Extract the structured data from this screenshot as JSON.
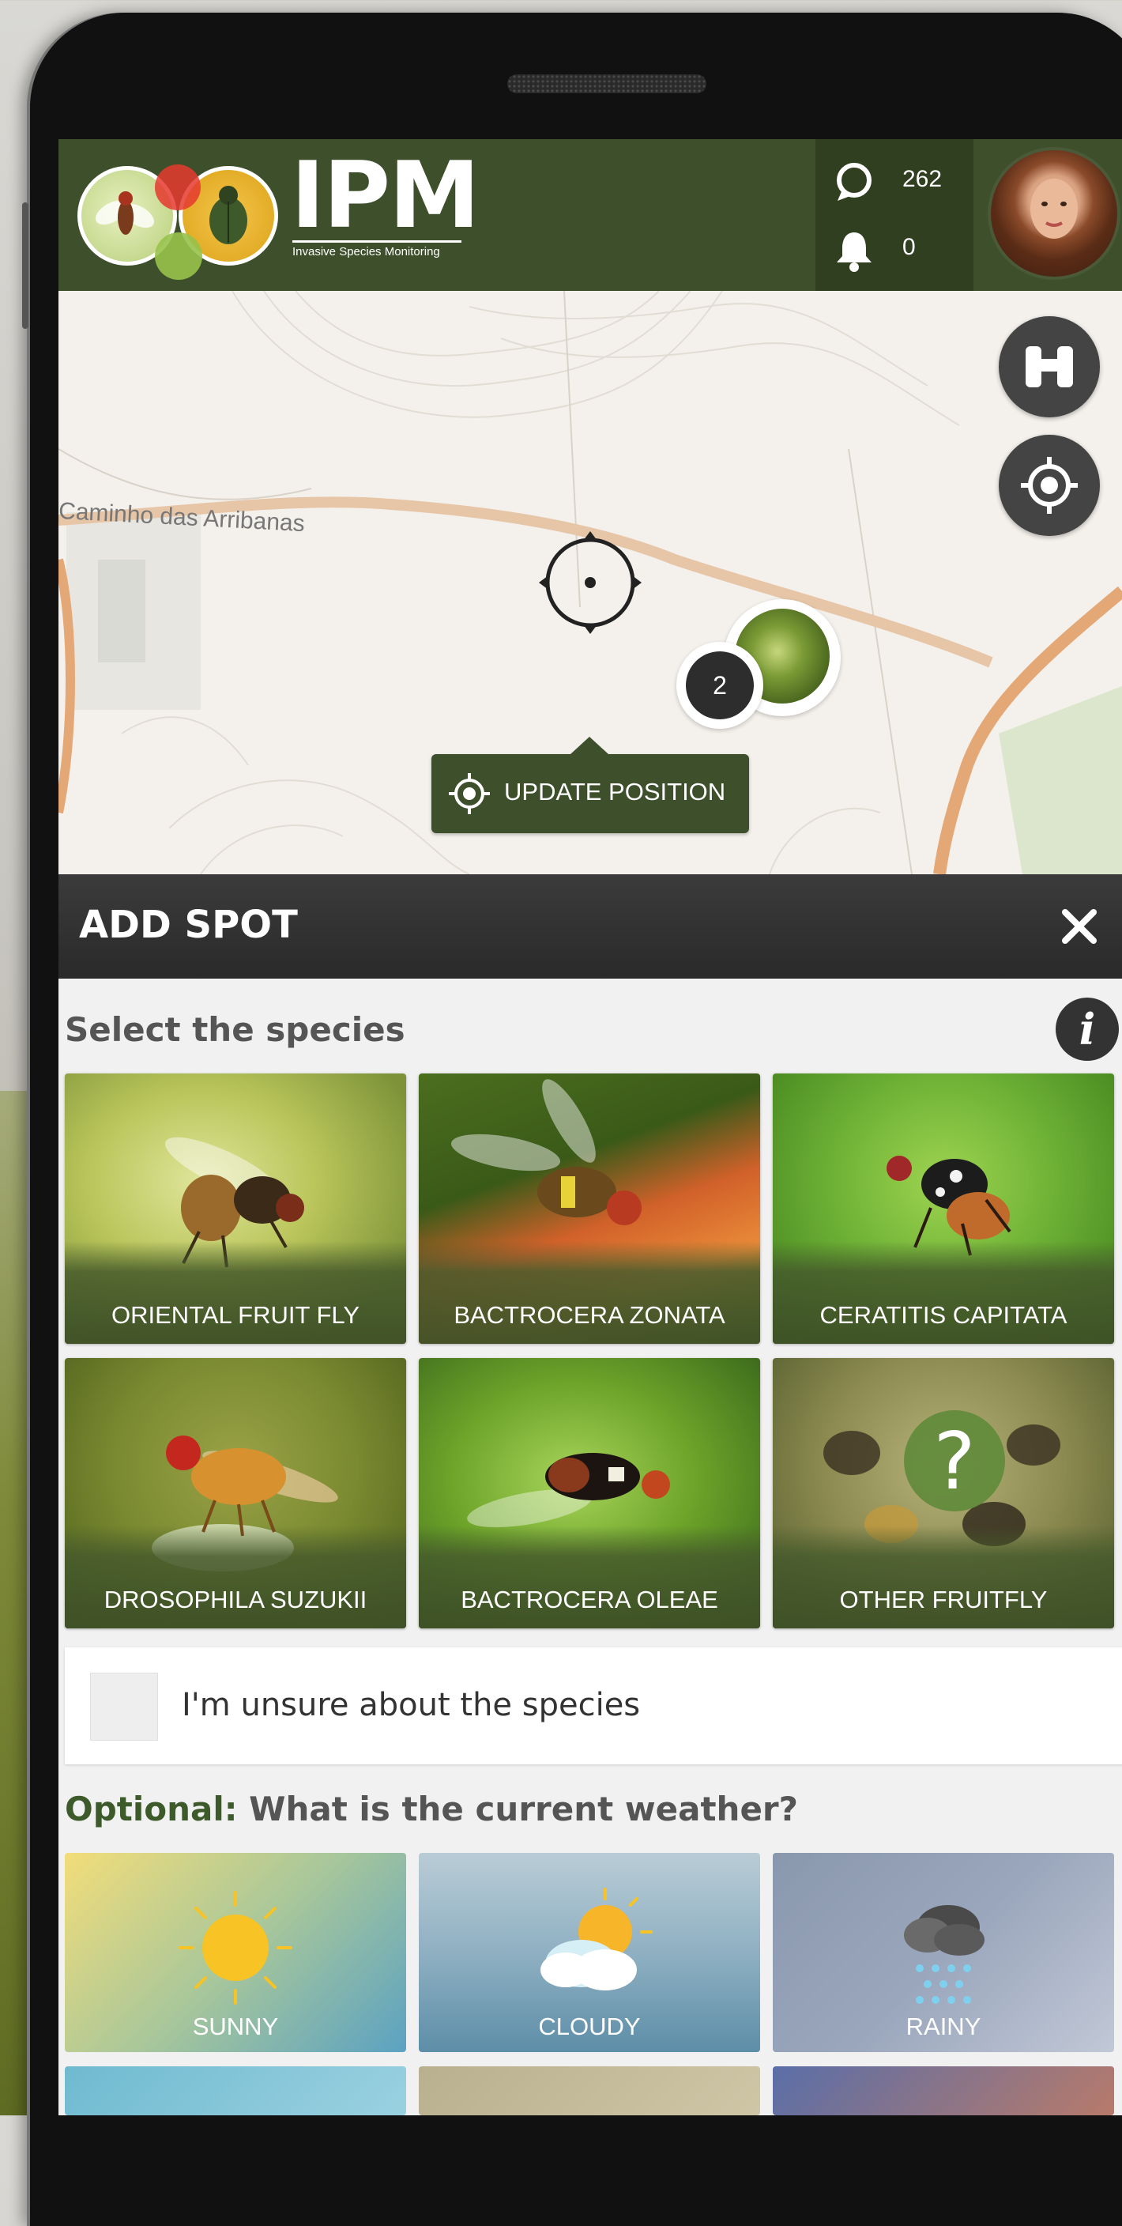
{
  "app": {
    "title": "IPM",
    "subtitle": "Invasive Species Monitoring"
  },
  "header": {
    "stats": [
      {
        "icon": "spot-marker-icon",
        "value": "262"
      },
      {
        "icon": "bell-icon",
        "value": "0"
      }
    ],
    "avatar": "user-avatar"
  },
  "map": {
    "road_label": "Caminho das Arribanas",
    "cluster_count": "2",
    "update_button": "UPDATE POSITION",
    "buttons": [
      "binoculars-icon",
      "locate-icon"
    ]
  },
  "add_spot": {
    "title": "ADD SPOT",
    "close_icon": "close-icon"
  },
  "species_section": {
    "label": "Select the species",
    "info_icon": "info-icon",
    "tiles": [
      {
        "label": "ORIENTAL FRUIT FLY"
      },
      {
        "label": "BACTROCERA ZONATA"
      },
      {
        "label": "CERATITIS CAPITATA"
      },
      {
        "label": "DROSOPHILA SUZUKII"
      },
      {
        "label": "BACTROCERA OLEAE"
      },
      {
        "label": "OTHER FRUITFLY"
      }
    ],
    "unsure_label": "I'm unsure about the species"
  },
  "weather_section": {
    "optional": "Optional:",
    "label": " What is the current weather?",
    "tiles": [
      {
        "label": "SUNNY",
        "icon": "sun-icon"
      },
      {
        "label": "CLOUDY",
        "icon": "cloud-sun-icon"
      },
      {
        "label": "RAINY",
        "icon": "rain-cloud-icon"
      }
    ]
  },
  "colors": {
    "brand_green": "#3d4f2b",
    "dark_bar": "#2f2f2f"
  }
}
